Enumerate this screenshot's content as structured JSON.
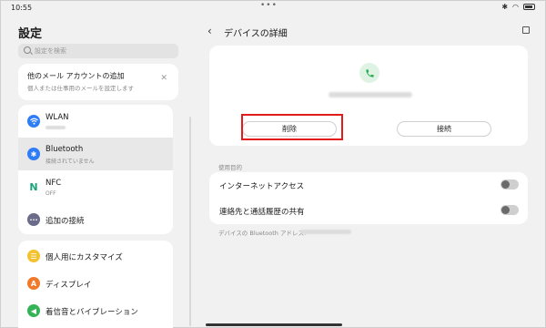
{
  "status": {
    "time": "10:55"
  },
  "sidebar": {
    "title": "設定",
    "search_placeholder": "設定を検索",
    "mail_card": {
      "title": "他のメール アカウントの追加",
      "subtitle": "個人または仕事用のメールを設定します"
    },
    "network_items": [
      {
        "label": "WLAN",
        "sub": "",
        "icon": "wifi-icon",
        "color": "#2f7df6"
      },
      {
        "label": "Bluetooth",
        "sub": "接続されていません",
        "icon": "bluetooth-icon",
        "color": "#2f7df6",
        "active": true
      },
      {
        "label": "NFC",
        "sub": "OFF",
        "icon": "nfc-icon",
        "color": "#1aa37a"
      },
      {
        "label": "追加の接続",
        "sub": "",
        "icon": "more-icon",
        "color": "#6b6b8a"
      }
    ],
    "personal_items": [
      {
        "label": "個人用にカスタマイズ",
        "icon": "customize-icon",
        "color": "#f2c230"
      },
      {
        "label": "ディスプレイ",
        "icon": "display-icon",
        "color": "#f07a2a"
      },
      {
        "label": "着信音とバイブレーション",
        "icon": "sound-icon",
        "color": "#35b457"
      }
    ]
  },
  "detail": {
    "title": "デバイスの詳細",
    "delete_label": "削除",
    "connect_label": "接続",
    "section_label": "使用目的",
    "options": [
      {
        "label": "インターネットアクセス",
        "on": false
      },
      {
        "label": "連絡先と通話履歴の共有",
        "on": false
      }
    ],
    "address_label": "デバイスの Bluetooth アドレス:"
  },
  "colors": {
    "highlight": "#e41b1b",
    "phone_accent": "#2aa84f"
  }
}
